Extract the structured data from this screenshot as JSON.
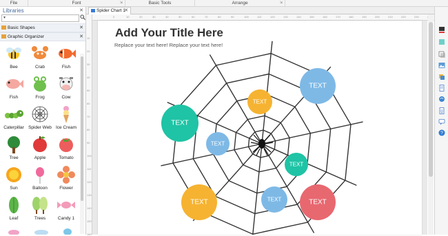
{
  "ribbon": {
    "groups": [
      {
        "label": "File",
        "expander": ""
      },
      {
        "label": "Font",
        "expander": "⇲"
      },
      {
        "label": "Basic Tools",
        "expander": ""
      },
      {
        "label": "Arrange",
        "expander": "⇲"
      }
    ]
  },
  "libraries": {
    "title": "Libraries",
    "search_value": "",
    "categories": [
      {
        "label": "Basic Shapes"
      },
      {
        "label": "Graphic Organizer"
      }
    ],
    "shapes": [
      {
        "label": "Bee",
        "icon": "bee-icon"
      },
      {
        "label": "Crab",
        "icon": "crab-icon"
      },
      {
        "label": "Fish",
        "icon": "fish-icon"
      },
      {
        "label": "Fish",
        "icon": "pink-fish-icon"
      },
      {
        "label": "Frog",
        "icon": "frog-icon"
      },
      {
        "label": "Cow",
        "icon": "cow-icon"
      },
      {
        "label": "Caterpillar",
        "icon": "caterpillar-icon"
      },
      {
        "label": "Spider Web",
        "icon": "spider-web-icon"
      },
      {
        "label": "Ice Cream",
        "icon": "ice-cream-icon"
      },
      {
        "label": "Tree",
        "icon": "tree-icon"
      },
      {
        "label": "Apple",
        "icon": "apple-icon"
      },
      {
        "label": "Tomato",
        "icon": "tomato-icon"
      },
      {
        "label": "Sun",
        "icon": "sun-icon"
      },
      {
        "label": "Balloon",
        "icon": "balloon-icon"
      },
      {
        "label": "Flower",
        "icon": "flower-icon"
      },
      {
        "label": "Leaf",
        "icon": "leaf-icon"
      },
      {
        "label": "Trees",
        "icon": "trees-icon"
      },
      {
        "label": "Candy 1",
        "icon": "candy-icon"
      }
    ]
  },
  "document": {
    "tab_label": "Spider Chart 1",
    "title": "Add Your Title Here",
    "subtitle": "Replace your text here!   Replace your text here!",
    "ruler_ticks": [
      "0",
      "10",
      "20",
      "30",
      "40",
      "50",
      "60",
      "70",
      "80",
      "90",
      "100",
      "110",
      "120",
      "130",
      "140",
      "150",
      "160",
      "170",
      "180",
      "190",
      "200",
      "210",
      "220",
      "230",
      "240",
      "250"
    ],
    "ruler_ticks_v": [
      "10",
      "20",
      "30",
      "40",
      "50",
      "60",
      "70",
      "80",
      "90",
      "100",
      "110",
      "120",
      "130",
      "140",
      "150",
      "160"
    ]
  },
  "diagram": {
    "bubbles": [
      {
        "text": "TEXT",
        "color": "#f6b331"
      },
      {
        "text": "TEXT",
        "color": "#7eb9e6"
      },
      {
        "text": "TEXT",
        "color": "#1fc3a5"
      },
      {
        "text": "TEXT",
        "color": "#7eb9e6"
      },
      {
        "text": "TEXT",
        "color": "#1fc3a5"
      },
      {
        "text": "TEXT",
        "color": "#f6b331"
      },
      {
        "text": "TEXT",
        "color": "#7eb9e6"
      },
      {
        "text": "TEXT",
        "color": "#e86870"
      }
    ]
  },
  "right_panel": {
    "icons": [
      "fill-icon",
      "line-icon",
      "shadow-icon",
      "image-icon",
      "layers-icon",
      "page-icon",
      "hyperlink-icon",
      "attachment-icon",
      "comment-icon",
      "help-icon"
    ]
  }
}
